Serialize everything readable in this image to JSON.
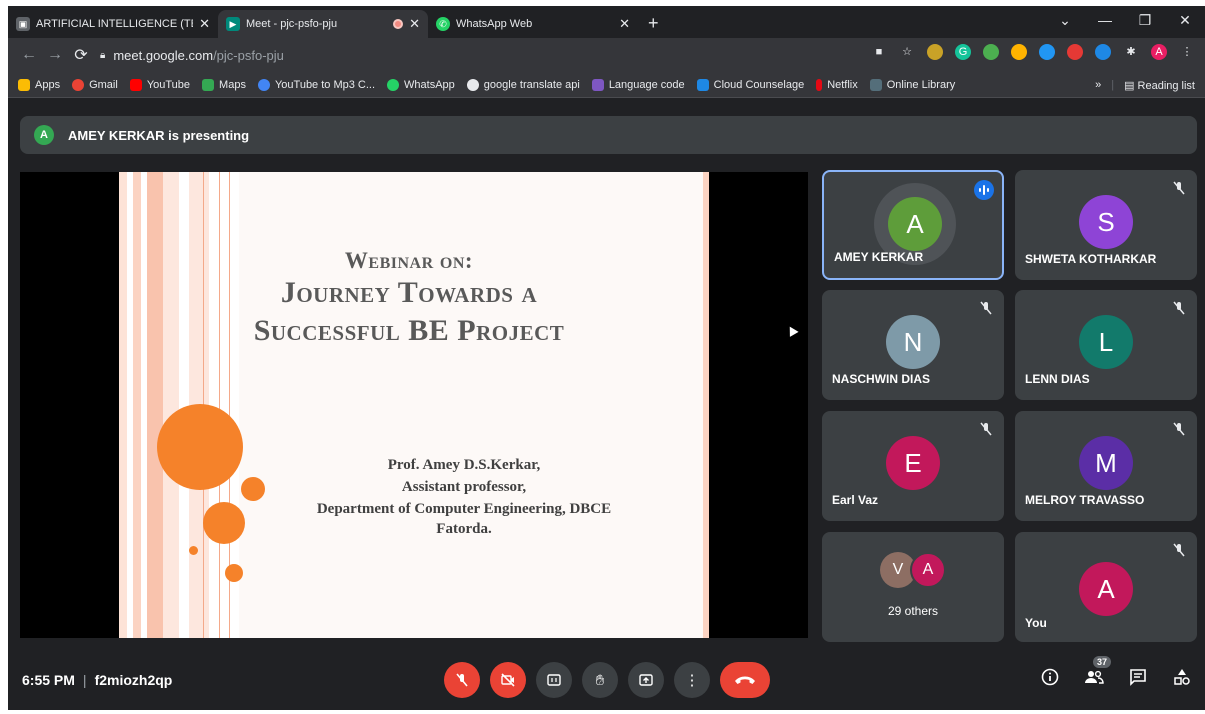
{
  "browser": {
    "tabs": [
      {
        "title": "ARTIFICIAL INTELLIGENCE (TE CO",
        "active": false
      },
      {
        "title": "Meet - pjc-psfo-pju",
        "active": true
      },
      {
        "title": "WhatsApp Web",
        "active": false
      }
    ],
    "new_tab": "+",
    "url_host": "meet.google.com",
    "url_path": "/pjc-psfo-pju",
    "profile_initial": "A"
  },
  "bookmarks": [
    {
      "label": "Apps",
      "color": "#fbbc04"
    },
    {
      "label": "Gmail",
      "color": "#ea4335"
    },
    {
      "label": "YouTube",
      "color": "#ff0000"
    },
    {
      "label": "Maps",
      "color": "#34a853"
    },
    {
      "label": "YouTube to Mp3 C...",
      "color": "#4285f4"
    },
    {
      "label": "WhatsApp",
      "color": "#25d366"
    },
    {
      "label": "google translate api",
      "color": "#9e9e9e"
    },
    {
      "label": "Language code",
      "color": "#7e57c2"
    },
    {
      "label": "Cloud Counselage",
      "color": "#1e88e5"
    },
    {
      "label": "Netflix",
      "color": "#e50914"
    },
    {
      "label": "Online Library",
      "color": "#546e7a"
    }
  ],
  "bookmarks_more": "»",
  "reading_list": "Reading list",
  "presenting": {
    "avatar": "A",
    "text": "AMEY KERKAR is presenting"
  },
  "slide": {
    "heading_small": "Webinar on:",
    "heading_line1": "Journey Towards a",
    "heading_line2": "Successful BE Project",
    "author_lines": [
      "Prof. Amey D.S.Kerkar,",
      "Assistant professor,",
      "Department of Computer Engineering, DBCE",
      "Fatorda."
    ]
  },
  "participants": [
    {
      "initial": "A",
      "name": "AMEY KERKAR",
      "color": "#5e9d3a",
      "speaking": true
    },
    {
      "initial": "S",
      "name": "SHWETA KOTHARKAR",
      "color": "#8e44d6",
      "muted": true
    },
    {
      "initial": "N",
      "name": "NASCHWIN DIAS",
      "color": "#7e9aa8",
      "muted": true
    },
    {
      "initial": "L",
      "name": "LENN DIAS",
      "color": "#127a6b",
      "muted": true
    },
    {
      "initial": "E",
      "name": "Earl Vaz",
      "color": "#c2185b",
      "muted": true
    },
    {
      "initial": "M",
      "name": "MELROY TRAVASSO",
      "color": "#5b2ea6",
      "muted": true
    },
    {
      "initial": "A",
      "name": "You",
      "color": "#c2185b",
      "muted": true
    }
  ],
  "others": {
    "initials": [
      "V",
      "A"
    ],
    "colors": [
      "#8d6e63",
      "#c2185b"
    ],
    "label": "29 others"
  },
  "meeting": {
    "time": "6:55 PM",
    "separator": "|",
    "code": "f2miozh2qp",
    "participant_count": "37"
  }
}
